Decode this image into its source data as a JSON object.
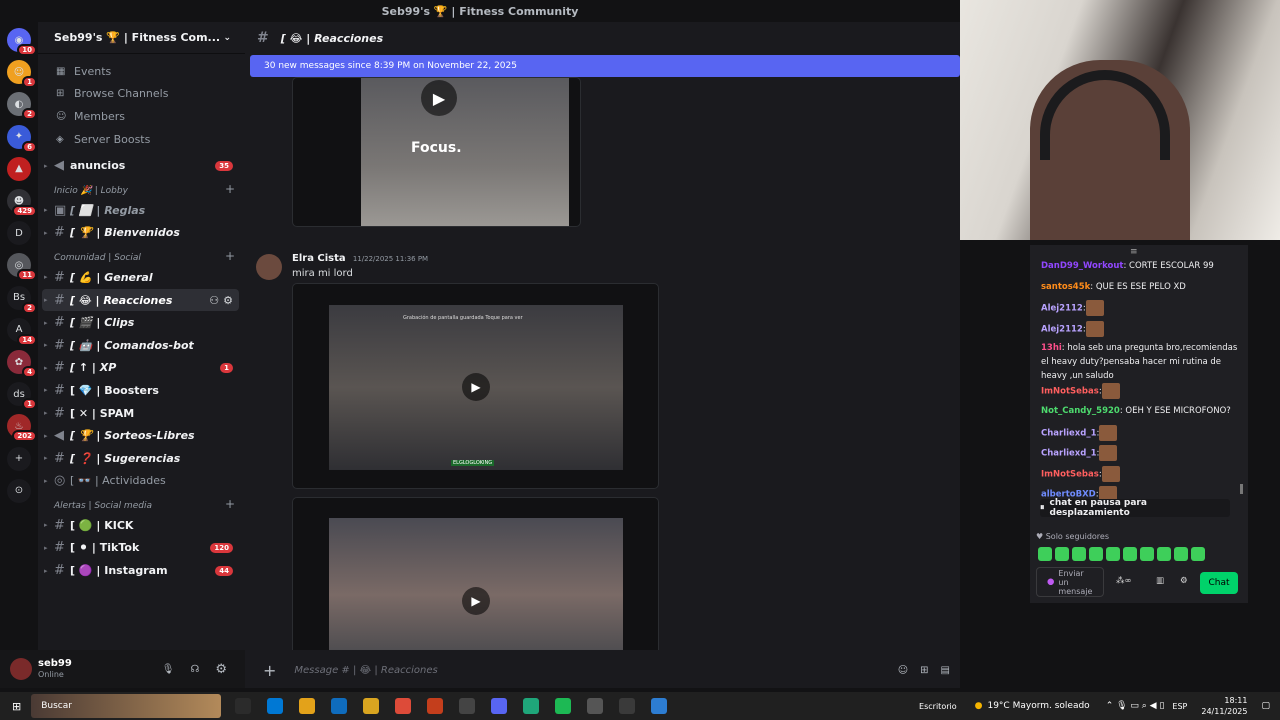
{
  "window_title": "Seb99's 🏆 | Fitness Community",
  "rail": [
    {
      "label": "◉",
      "badge": "10",
      "color": "#5865f2"
    },
    {
      "label": "☺",
      "badge": "1",
      "color": "#f0a020"
    },
    {
      "label": "◐",
      "badge": "2",
      "color": "#6b6f75"
    },
    {
      "label": "✦",
      "badge": "6",
      "color": "#3a5bd9"
    },
    {
      "label": "▲",
      "badge": "",
      "color": "#c02020"
    },
    {
      "label": "☻",
      "badge": "429",
      "color": "#303035"
    },
    {
      "label": "D",
      "badge": "",
      "color": "#1a1a1e"
    },
    {
      "label": "◎",
      "badge": "11",
      "color": "#55575c"
    },
    {
      "label": "Bs",
      "badge": "2",
      "color": "#1a1a1e"
    },
    {
      "label": "A",
      "badge": "14",
      "color": "#1a1a1e"
    },
    {
      "label": "✿",
      "badge": "4",
      "color": "#8a2a3a"
    },
    {
      "label": "ds",
      "badge": "1",
      "color": "#1a1a1e"
    },
    {
      "label": "♨",
      "badge": "202",
      "color": "#a02828"
    },
    {
      "label": "+",
      "badge": "",
      "color": "#1a1a1e"
    },
    {
      "label": "⊙",
      "badge": "",
      "color": "#1a1a1e"
    }
  ],
  "server_name": "Seb99's 🏆 | Fitness Com...",
  "nav_items": [
    {
      "icon": "▦",
      "label": "Events"
    },
    {
      "icon": "⊞",
      "label": "Browse Channels"
    },
    {
      "icon": "☺",
      "label": "Members"
    },
    {
      "icon": "◈",
      "label": "Server Boosts"
    }
  ],
  "announcement": {
    "label": "anuncios",
    "count": "35"
  },
  "categories": [
    {
      "name": "Inicio 🎉 | Lobby",
      "channels": [
        {
          "hash": "▣",
          "label": "[ ⬜ | Reglas",
          "style": "it",
          "count": ""
        },
        {
          "hash": "#",
          "label": "[ 🏆 | Bienvenidos",
          "style": "u it",
          "count": ""
        }
      ]
    },
    {
      "name": "Comunidad | Social",
      "channels": [
        {
          "hash": "#",
          "label": "[ 💪 | General",
          "style": "u it",
          "count": ""
        },
        {
          "hash": "#",
          "label": "[ 😂 | Reacciones",
          "style": "u it sel",
          "count": ""
        },
        {
          "hash": "#",
          "label": "[ 🎬 | Clips",
          "style": "u it",
          "count": ""
        },
        {
          "hash": "#",
          "label": "[ 🤖 | Comandos-bot",
          "style": "u it",
          "count": ""
        },
        {
          "hash": "#",
          "label": "[ ↑ | XP",
          "style": "u it",
          "count": "1"
        },
        {
          "hash": "#",
          "label": "[ 💎 | Boosters",
          "style": "u",
          "count": ""
        },
        {
          "hash": "#",
          "label": "[ ✕ | SPAM",
          "style": "u",
          "count": ""
        },
        {
          "hash": "◀",
          "label": "[ 🏆 | Sorteos-Libres",
          "style": "u it",
          "count": ""
        },
        {
          "hash": "#",
          "label": "[ ❓ | Sugerencias",
          "style": "u it",
          "count": ""
        },
        {
          "hash": "◎",
          "label": "[ 👓 | Actividades",
          "style": "",
          "count": ""
        }
      ]
    },
    {
      "name": "Alertas | Social media",
      "channels": [
        {
          "hash": "#",
          "label": "[ 🟢 | KICK",
          "style": "u",
          "count": ""
        },
        {
          "hash": "#",
          "label": "[ ⚫ | TikTok",
          "style": "u",
          "count": "120"
        },
        {
          "hash": "#",
          "label": "[ 🟣 | Instagram",
          "style": "u",
          "count": "44"
        }
      ]
    }
  ],
  "user": {
    "name": "seb99",
    "status": "Online"
  },
  "channel_header": "[ 😂 | Reacciones",
  "new_messages_bar": "30 new messages since 8:39 PM on November 22, 2025",
  "video1_caption": "Focus.",
  "message": {
    "author": "Elra Cista",
    "time": "11/22/2025 11:36 PM",
    "text": "mira mi lord"
  },
  "video2_overlay": "Grabación de pantalla guardada  Toque para ver",
  "video2_watermark": "ELGLOGLOKING",
  "composer_placeholder": "Message #  | 😂 | Reacciones",
  "twitch": {
    "messages": [
      {
        "user": "DanD99_Workout",
        "color": "#9147ff",
        "text": ": CORTE ESCOLAR 99"
      },
      {
        "user": "santos45k",
        "color": "#ff8c1a",
        "text": ": QUE ES ESE PELO XD"
      },
      {
        "user": "Alej2112",
        "color": "#b9a3ff",
        "text": ":",
        "emote": true
      },
      {
        "user": "Alej2112",
        "color": "#b9a3ff",
        "text": ":",
        "emote": true
      },
      {
        "user": "13hi",
        "color": "#ff4f8b",
        "text": ": hola seb una pregunta bro,recomiendas el heavy duty?pensaba hacer mi rutina de heavy ,un saludo"
      },
      {
        "user": "ImNotSebas",
        "color": "#ff5f5f",
        "text": ":",
        "emote": true
      },
      {
        "user": "Not_Candy_5920",
        "color": "#4ddb6e",
        "text": ": OEH Y ESE MICROFONO?"
      },
      {
        "user": "Charliexd_1",
        "color": "#b9a3ff",
        "text": ":",
        "emote": true
      },
      {
        "user": "Charliexd_1",
        "color": "#b9a3ff",
        "text": ":",
        "emote": true
      },
      {
        "user": "ImNotSebas",
        "color": "#ff5f5f",
        "text": ":",
        "emote": true
      },
      {
        "user": "albertoBXD",
        "color": "#6f8cff",
        "text": ":",
        "emote": true
      }
    ],
    "pause_text": "chat en pausa para desplazamiento",
    "followers_only": "Solo seguidores",
    "input_placeholder": "Enviar un mensaje",
    "chat_button": "Chat"
  },
  "taskbar": {
    "search": "Buscar",
    "desktop_label": "Escritorio",
    "weather": "19°C  Mayorm. soleado",
    "lang": "ESP",
    "time": "18:11",
    "date": "24/11/2025"
  }
}
